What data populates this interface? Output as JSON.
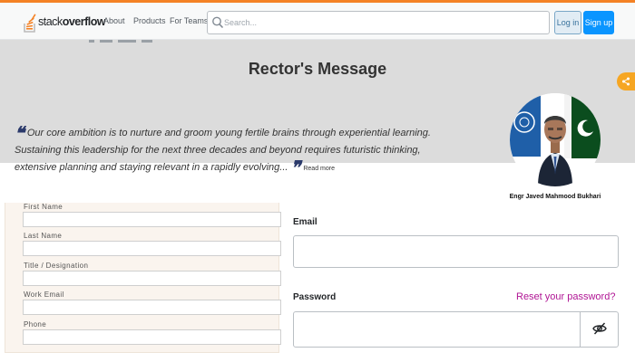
{
  "topbar": {
    "logo": {
      "text_light": "stack",
      "text_bold": "overflow",
      "icon": "stack-overflow-logo-icon",
      "accent": "#f48225"
    },
    "nav": [
      "About",
      "Products",
      "For Teams"
    ],
    "search": {
      "placeholder": "Search...",
      "icon": "search-icon"
    },
    "login_label": "Log in",
    "signup_label": "Sign up",
    "signup_color": "#0a95ff"
  },
  "rector": {
    "title": "Rector's Message",
    "quote": "Our core ambition is to nurture and groom young fertile brains through experiential learning. Sustaining this leadership for the next three decades and beyond requires futuristic thinking, extensive planning and staying relevant in a rapidly evolving...",
    "open_quote": "❝",
    "close_quote": "❞",
    "read_more": "Read more",
    "name": "Engr Javed Mahmood Bukhari",
    "share_icon": "share-icon",
    "share_color": "#f6a623"
  },
  "signup_form": {
    "fields": [
      {
        "label": "First Name",
        "value": ""
      },
      {
        "label": "Last Name",
        "value": ""
      },
      {
        "label": "Title / Designation",
        "value": ""
      },
      {
        "label": "Work Email",
        "value": ""
      },
      {
        "label": "Phone",
        "value": ""
      }
    ]
  },
  "login_form": {
    "email_label": "Email",
    "email_value": "",
    "password_label": "Password",
    "password_value": "",
    "reset_link": "Reset your password?",
    "reset_color": "#b01594",
    "toggle_icon": "eye-off-icon"
  }
}
